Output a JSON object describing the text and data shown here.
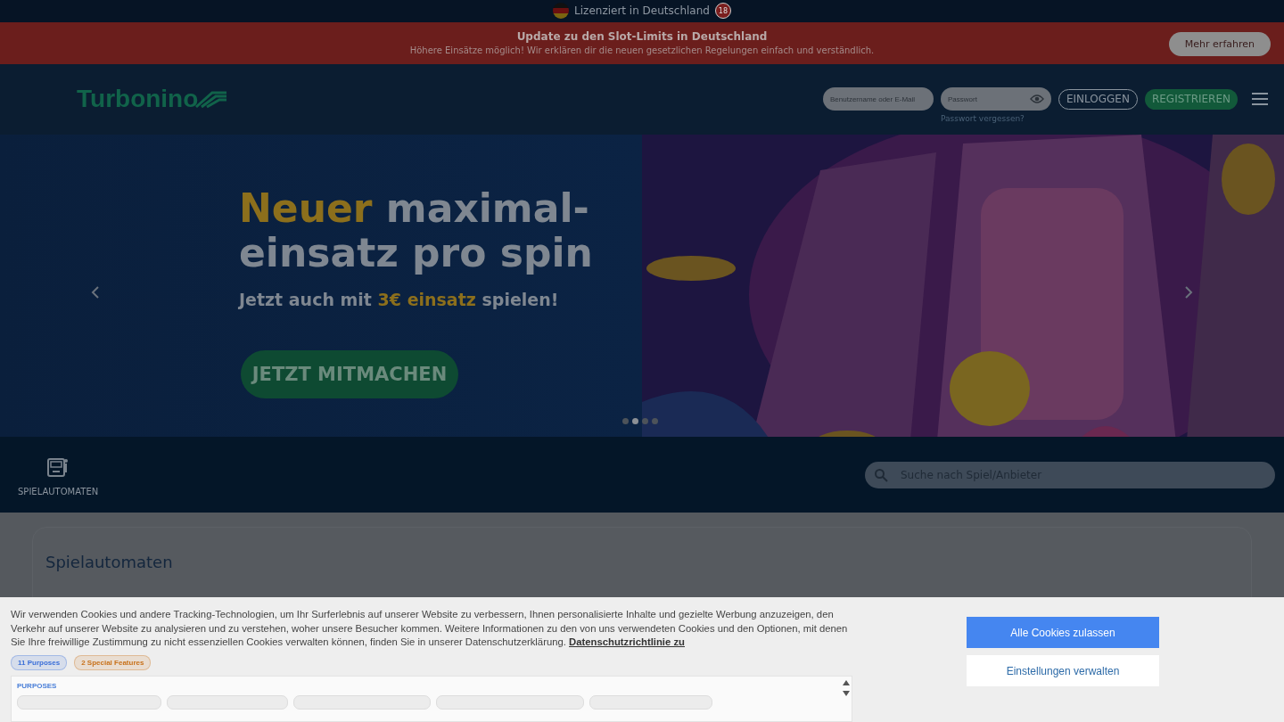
{
  "license_bar": {
    "text": "Lizenziert in Deutschland",
    "age_badge": "18"
  },
  "notice": {
    "title": "Update zu den Slot-Limits in Deutschland",
    "text": "Höhere Einsätze möglich! Wir erklären dir die neuen gesetzlichen Regelungen einfach und verständlich.",
    "button": "Mehr erfahren"
  },
  "header": {
    "logo": "Turbonino",
    "username": {
      "placeholder": "Benutzername oder E-Mail"
    },
    "password": {
      "placeholder": "Passwort"
    },
    "forgot": "Passwort vergessen?",
    "login": "EINLOGGEN",
    "register": "REGISTRIEREN"
  },
  "hero": {
    "headline_highlight": "Neuer",
    "headline_rest": "maximal-einsatz pro spin",
    "sub_before": "Jetzt auch mit",
    "sub_highlight": "3€ einsatz",
    "sub_after": "spielen!",
    "cta": "JETZT MITMACHEN",
    "dots": [
      {
        "selected": false
      },
      {
        "selected": true
      },
      {
        "selected": false
      },
      {
        "selected": false
      }
    ]
  },
  "categories": [
    {
      "label": "SPIELAUTOMATEN",
      "selected": true
    }
  ],
  "search": {
    "placeholder": "Suche nach Spiel/Anbieter"
  },
  "section": {
    "title": "Spielautomaten"
  },
  "cookie": {
    "text": "Wir verwenden Cookies und andere Tracking-Technologien, um Ihr Surferlebnis auf unserer Website zu verbessern, Ihnen personalisierte Inhalte und gezielte Werbung anzuzeigen, den Verkehr auf unserer Website zu analysieren und zu verstehen, woher unsere Besucher kommen. Weitere Informationen zu den von uns verwendeten Cookies und den Optionen, mit denen Sie Ihre freiwillige Zustimmung zu nicht essenziellen Cookies verwalten können, finden Sie in unserer Datenschutzerklärung.",
    "link": "Datenschutzrichtlinie zu",
    "tags": [
      {
        "label": "11 Purposes",
        "color": "#3b6fd8"
      },
      {
        "label": "2 Special Features",
        "color": "#c8711a"
      }
    ],
    "purposes_title": "PURPOSES",
    "accept": "Alle Cookies zulassen",
    "manage": "Einstellungen verwalten"
  }
}
